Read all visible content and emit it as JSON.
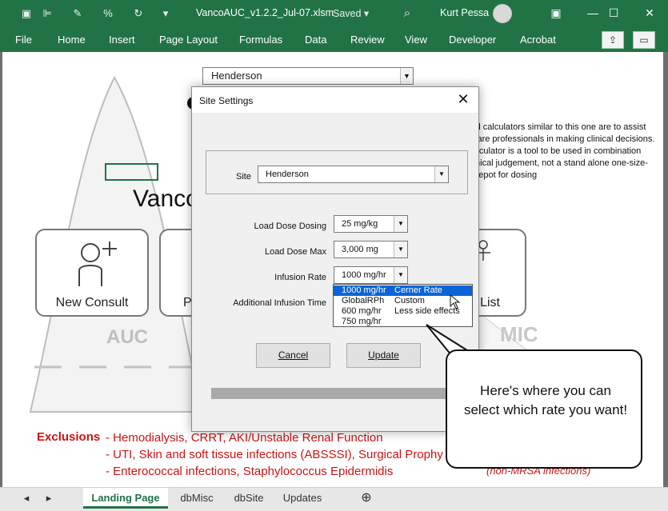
{
  "titlebar": {
    "document_title": "VancoAUC_v1.2.2_Jul-07.xlsm",
    "save_status": "Saved",
    "user_name": "Kurt Pessa",
    "qa_icons": [
      "save-icon",
      "format-painter-icon",
      "spelling-icon",
      "paint-icon",
      "redo-icon",
      "customize-icon"
    ],
    "search_icon": "search-icon"
  },
  "menubar": {
    "items": [
      "File",
      "Home",
      "Insert",
      "Page Layout",
      "Formulas",
      "Data",
      "Review",
      "View",
      "Developer",
      "Acrobat"
    ]
  },
  "sheet": {
    "site_dropdown_value": "Henderson",
    "title_fragment": "Vanco",
    "disclaimer": "*Clinical calculators similar to this one are to assist healthcare professionals in making clinical decisions. This calculator is a tool to be used in combination with clinical judgement, not a stand alone one-size-fits all depot for dosing",
    "cards": [
      {
        "label": "New Consult"
      },
      {
        "label": "Po"
      },
      {
        "label": "List"
      }
    ],
    "auc_label": "AUC",
    "mic_label": "MIC",
    "exclusions_title": "Exclusions",
    "exclusions": [
      "- Hemodialysis, CRRT, AKI/Unstable Renal Function",
      "- UTI, Skin and soft tissue infections (ABSSSI), Surgical Prophy",
      "- Enterococcal infections, Staphylococcus Epidermidis"
    ],
    "non_mrsa_note": "(non-MRSA infections)"
  },
  "tabs": {
    "items": [
      "Landing Page",
      "dbMisc",
      "dbSite",
      "Updates"
    ],
    "active": "Landing Page"
  },
  "dialog": {
    "title": "Site Settings",
    "site_label": "Site",
    "site_value": "Henderson",
    "load_dose_dosing_label": "Load Dose Dosing",
    "load_dose_dosing_value": "25 mg/kg",
    "load_dose_max_label": "Load Dose Max",
    "load_dose_max_value": "3,000 mg",
    "infusion_rate_label": "Infusion Rate",
    "infusion_rate_value": "1000 mg/hr",
    "additional_infusion_label": "Additional Infusion Time",
    "cancel_label": "Cancel",
    "update_label": "Update"
  },
  "rate_options": [
    {
      "rate": "1000 mg/hr",
      "desc": "Cerner Rate",
      "selected": true
    },
    {
      "rate": "GlobalRPh",
      "desc": "Custom",
      "selected": false
    },
    {
      "rate": "600 mg/hr",
      "desc": "Less side effects",
      "selected": false
    },
    {
      "rate": "750 mg/hr",
      "desc": "",
      "selected": false
    }
  ],
  "callout": {
    "text": "Here's where you can select which rate you want!"
  },
  "colors": {
    "excel_green": "#217346",
    "exclusion_red": "#d11212",
    "selection_blue": "#0a64d8"
  }
}
